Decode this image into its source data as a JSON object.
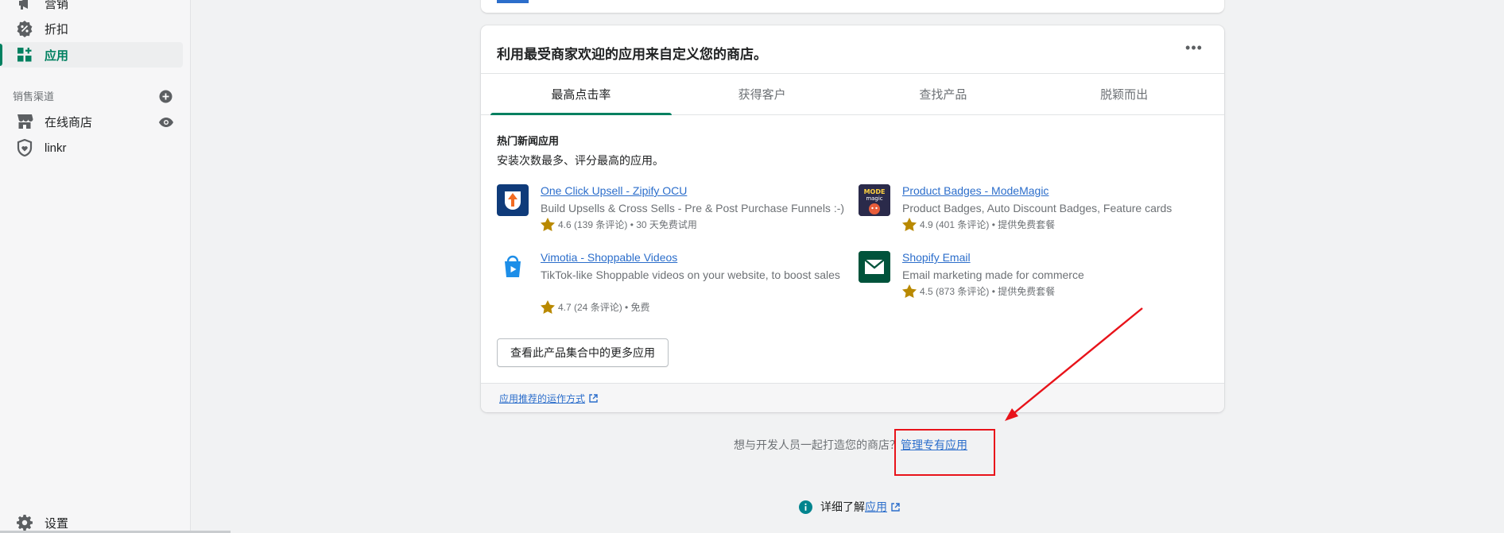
{
  "sidebar": {
    "items": [
      {
        "label": "营销",
        "icon": "megaphone-icon"
      },
      {
        "label": "折扣",
        "icon": "discount-icon"
      },
      {
        "label": "应用",
        "icon": "apps-icon",
        "active": true
      }
    ],
    "sales_channels_label": "销售渠道",
    "channels": [
      {
        "label": "在线商店",
        "icon": "store-icon"
      },
      {
        "label": "linkr",
        "icon": "linkr-shield-icon"
      }
    ],
    "settings_label": "设置"
  },
  "card": {
    "title": "利用最受商家欢迎的应用来自定义您的商店。",
    "more_label": "•••",
    "tabs": [
      {
        "label": "最高点击率",
        "active": true
      },
      {
        "label": "获得客户"
      },
      {
        "label": "查找产品"
      },
      {
        "label": "脱颖而出"
      }
    ],
    "section_heading": "热门新闻应用",
    "section_desc": "安装次数最多、评分最高的应用。",
    "apps": [
      {
        "name": "One Click Upsell - Zipify OCU",
        "desc": "Build Upsells & Cross Sells - Pre & Post Purchase Funnels :-)",
        "rating": "4.6 (139 条评论) • 30 天免费试用"
      },
      {
        "name": "Product Badges - ModeMagic",
        "desc": "Product Badges, Auto Discount Badges, Feature cards",
        "rating": "4.9 (401 条评论) • 提供免费套餐"
      },
      {
        "name": "Vimotia - Shoppable Videos",
        "desc": "TikTok-like Shoppable videos on your website, to boost sales",
        "rating": "4.7 (24 条评论) • 免费"
      },
      {
        "name": "Shopify Email",
        "desc": "Email marketing made for commerce",
        "rating": "4.5 (873 条评论) • 提供免费套餐"
      }
    ],
    "view_more_label": "查看此产品集合中的更多应用",
    "footer_link": "应用推荐的运作方式"
  },
  "custom_apps": {
    "prompt": "想与开发人员一起打造您的商店？",
    "link": "管理专有应用"
  },
  "learn_more": {
    "prefix": "详细了解",
    "link": "应用"
  },
  "colors": {
    "accent": "#008060",
    "link": "#2c6ecb",
    "annotation": "#e8131a"
  }
}
